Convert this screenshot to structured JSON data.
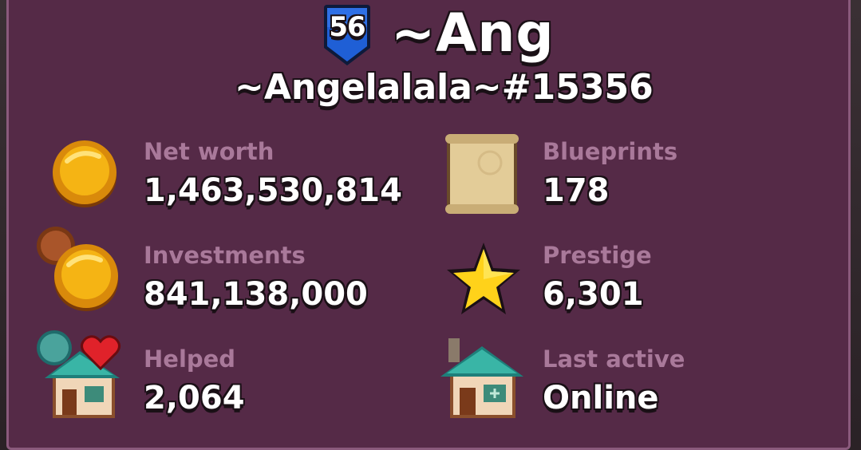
{
  "player": {
    "level": "56",
    "name": "~Ang",
    "tag": "~Angelalala~#15356"
  },
  "stats": {
    "net_worth": {
      "label": "Net worth",
      "value": "1,463,530,814",
      "icon": "gold-coin-icon"
    },
    "investments": {
      "label": "Investments",
      "value": "841,138,000",
      "icon": "investment-coins-icon"
    },
    "helped": {
      "label": "Helped",
      "value": "2,064",
      "icon": "shop-heart-icon"
    },
    "blueprints": {
      "label": "Blueprints",
      "value": "178",
      "icon": "blueprint-scroll-icon"
    },
    "prestige": {
      "label": "Prestige",
      "value": "6,301",
      "icon": "star-icon"
    },
    "last_active": {
      "label": "Last active",
      "value": "Online",
      "icon": "shop-icon"
    }
  },
  "colors": {
    "panel_bg": "#552a47",
    "label": "#a9799a",
    "badge_blue": "#1f5fd6",
    "gold": "#f5b414"
  }
}
